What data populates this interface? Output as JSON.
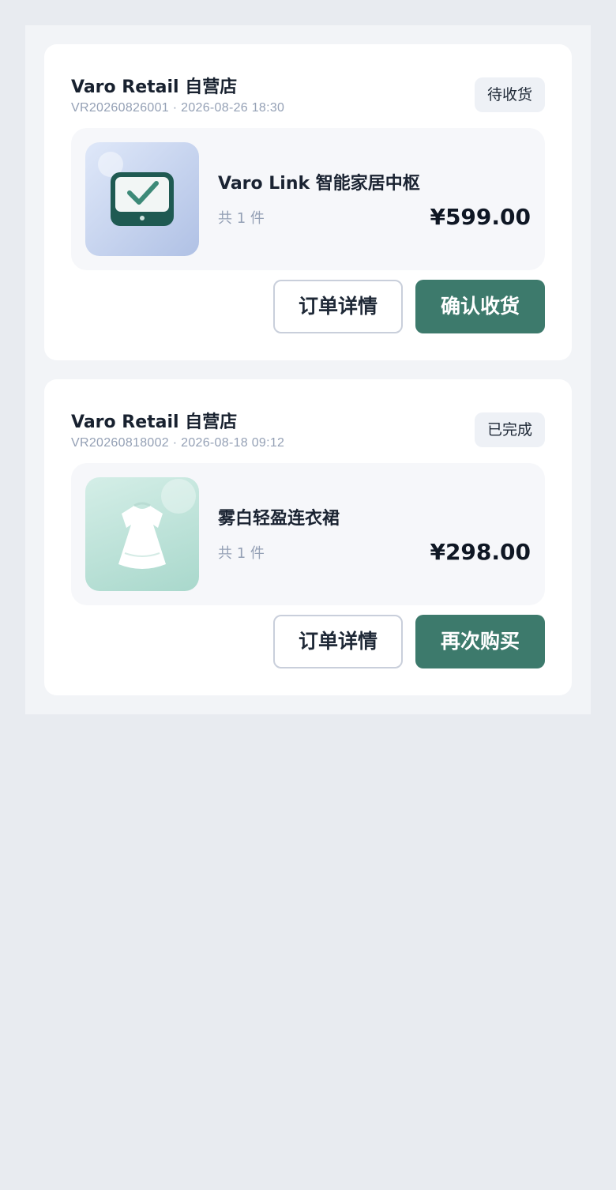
{
  "orders": [
    {
      "shop": "Varo Retail 自营店",
      "meta": "VR20260826001 · 2026-08-26 18:30",
      "status": "待收货",
      "product_name": "Varo Link 智能家居中枢",
      "quantity": "共 1 件",
      "price": "¥599.00",
      "thumb_icon": "smart-hub-icon",
      "buttons": {
        "secondary": "订单详情",
        "primary": "确认收货"
      }
    },
    {
      "shop": "Varo Retail 自营店",
      "meta": "VR20260818002 · 2026-08-18 09:12",
      "status": "已完成",
      "product_name": "雾白轻盈连衣裙",
      "quantity": "共 1 件",
      "price": "¥298.00",
      "thumb_icon": "dress-icon",
      "buttons": {
        "secondary": "订单详情",
        "primary": "再次购买"
      }
    }
  ],
  "colors": {
    "accent": "#3d7a6c",
    "page_bg": "#e8ebf0",
    "card_bg": "#ffffff"
  }
}
